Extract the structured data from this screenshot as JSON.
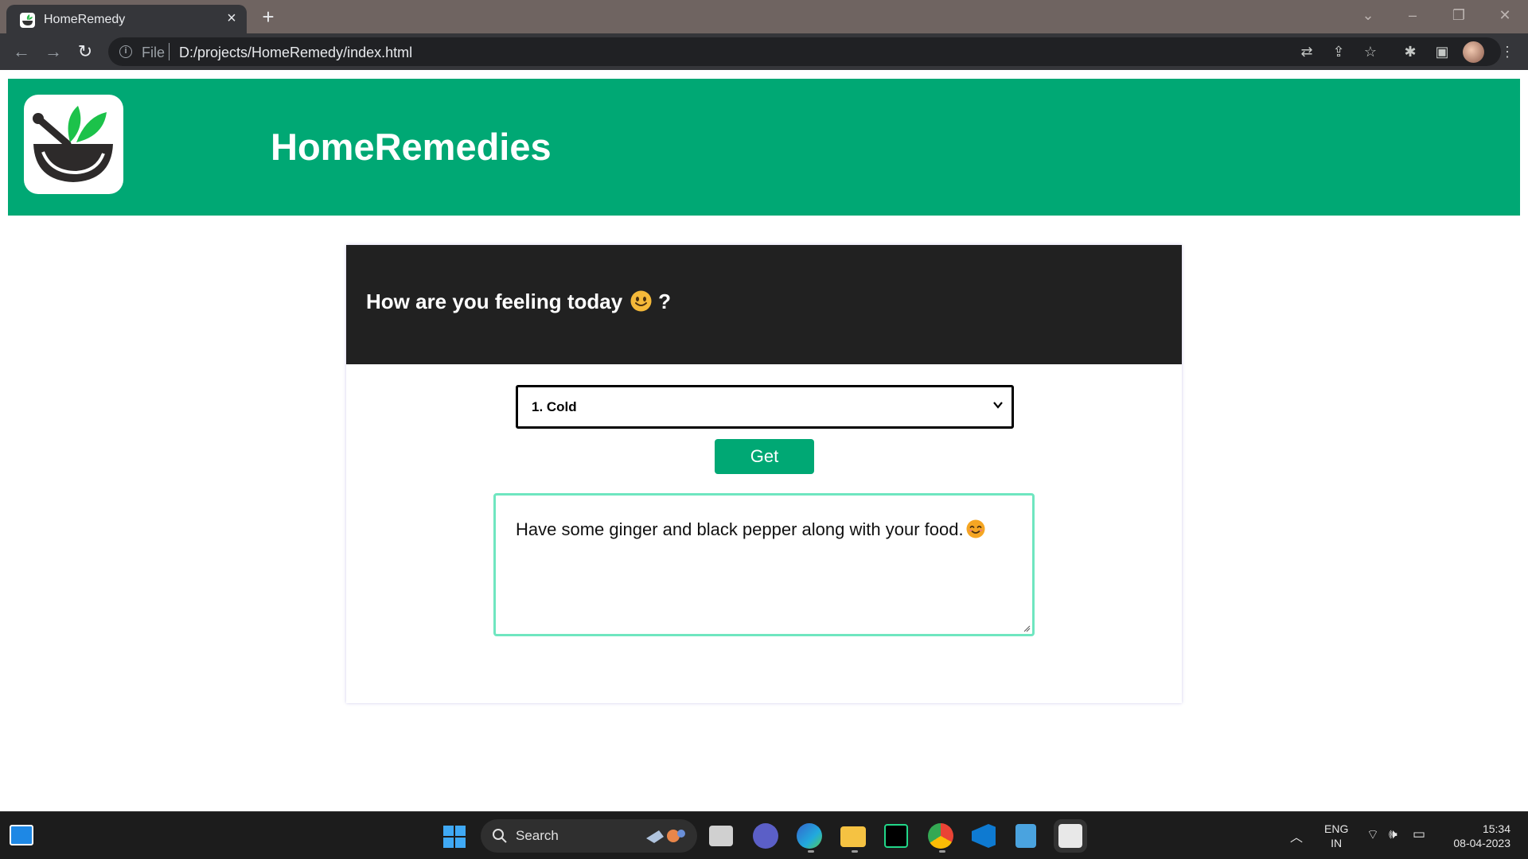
{
  "browser": {
    "tab_title": "HomeRemedy",
    "url_scheme": "File",
    "url": "D:/projects/HomeRemedy/index.html"
  },
  "header": {
    "site_title": "HomeRemedies",
    "brand_color": "#00a874"
  },
  "card": {
    "question": "How are you feeling today",
    "question_suffix": "?",
    "select_value": "1. Cold",
    "button_label": "Get",
    "remedy_text": "Have some ginger and black pepper along with your food."
  },
  "taskbar": {
    "search_label": "Search",
    "lang_line1": "ENG",
    "lang_line2": "IN",
    "time": "15:34",
    "date": "08-04-2023"
  }
}
